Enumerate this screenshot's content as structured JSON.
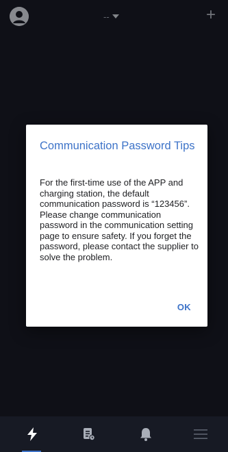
{
  "header": {
    "station_label": "--",
    "add_symbol": "+"
  },
  "dialog": {
    "title": "Communication Password Tips",
    "body": "For the first-time use of the APP and charging station, the default communication password is “123456”. Please change communication password in the communication setting page to ensure safety. If you forget the password, please contact the supplier to solve the problem.",
    "ok_label": "OK"
  },
  "bottom_nav": {
    "items": [
      {
        "icon": "lightning-icon",
        "active": true
      },
      {
        "icon": "records-icon",
        "active": false
      },
      {
        "icon": "bell-icon",
        "active": false
      },
      {
        "icon": "menu-icon",
        "active": false
      }
    ]
  },
  "colors": {
    "background": "#171a24",
    "accent": "#3d73c8",
    "dialog_bg": "#ffffff"
  }
}
